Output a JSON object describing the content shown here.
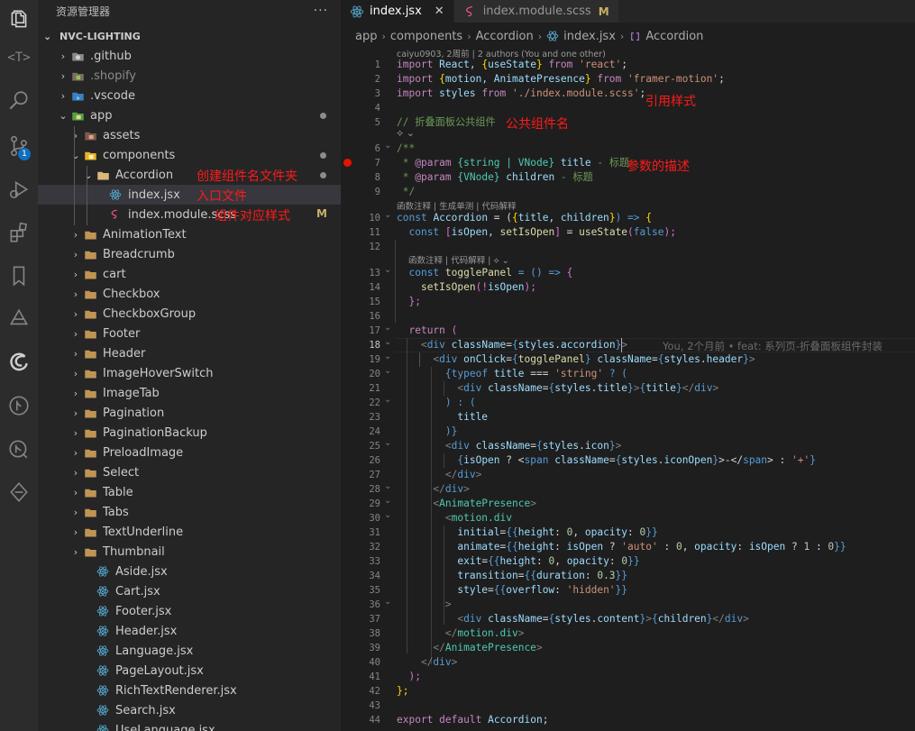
{
  "explorer": {
    "title": "资源管理器",
    "more": "···",
    "root": "NVC-LIGHTING",
    "items": [
      {
        "label": ".github",
        "kind": "folder",
        "chevron": "›"
      },
      {
        "label": ".shopify",
        "kind": "folder",
        "chevron": "›"
      },
      {
        "label": ".vscode",
        "kind": "folder",
        "chevron": "›"
      },
      {
        "label": "app",
        "kind": "folder-open",
        "chevron": "⌄"
      },
      {
        "label": "assets",
        "kind": "folder",
        "chevron": "›"
      },
      {
        "label": "components",
        "kind": "folder-open",
        "chevron": "⌄"
      },
      {
        "label": "Accordion",
        "kind": "folder-open",
        "chevron": "⌄",
        "note": "创建组件名文件夹"
      },
      {
        "label": "index.jsx",
        "kind": "react",
        "note": "入口文件"
      },
      {
        "label": "index.module.scss",
        "kind": "scss",
        "note": "组件对应样式",
        "badge": "M"
      },
      {
        "label": "AnimationText",
        "kind": "folder",
        "chevron": "›"
      },
      {
        "label": "Breadcrumb",
        "kind": "folder",
        "chevron": "›"
      },
      {
        "label": "cart",
        "kind": "folder",
        "chevron": "›"
      },
      {
        "label": "Checkbox",
        "kind": "folder",
        "chevron": "›"
      },
      {
        "label": "CheckboxGroup",
        "kind": "folder",
        "chevron": "›"
      },
      {
        "label": "Footer",
        "kind": "folder",
        "chevron": "›"
      },
      {
        "label": "Header",
        "kind": "folder",
        "chevron": "›"
      },
      {
        "label": "ImageHoverSwitch",
        "kind": "folder",
        "chevron": "›"
      },
      {
        "label": "ImageTab",
        "kind": "folder",
        "chevron": "›"
      },
      {
        "label": "Pagination",
        "kind": "folder",
        "chevron": "›"
      },
      {
        "label": "PaginationBackup",
        "kind": "folder",
        "chevron": "›"
      },
      {
        "label": "PreloadImage",
        "kind": "folder",
        "chevron": "›"
      },
      {
        "label": "Select",
        "kind": "folder",
        "chevron": "›"
      },
      {
        "label": "Table",
        "kind": "folder",
        "chevron": "›"
      },
      {
        "label": "Tabs",
        "kind": "folder",
        "chevron": "›"
      },
      {
        "label": "TextUnderline",
        "kind": "folder",
        "chevron": "›"
      },
      {
        "label": "Thumbnail",
        "kind": "folder",
        "chevron": "›"
      },
      {
        "label": "Aside.jsx",
        "kind": "react"
      },
      {
        "label": "Cart.jsx",
        "kind": "react"
      },
      {
        "label": "Footer.jsx",
        "kind": "react"
      },
      {
        "label": "Header.jsx",
        "kind": "react"
      },
      {
        "label": "Language.jsx",
        "kind": "react"
      },
      {
        "label": "PageLayout.jsx",
        "kind": "react"
      },
      {
        "label": "RichTextRenderer.jsx",
        "kind": "react"
      },
      {
        "label": "Search.jsx",
        "kind": "react"
      },
      {
        "label": "UseLanguage.jsx",
        "kind": "react"
      }
    ]
  },
  "activity_badge": "1",
  "activity_text_icon": "<T>",
  "tabs": [
    {
      "label": "index.jsx",
      "close": "✕"
    },
    {
      "label": "index.module.scss",
      "modified": "M"
    }
  ],
  "breadcrumb": [
    "app",
    "components",
    "Accordion",
    "index.jsx",
    "Accordion"
  ],
  "codelens": {
    "author": "caiyu0903, 2周前 | 2 authors (You and one other)",
    "lens1": "函数注释 | 生成单测 | 代码解释",
    "lens2": "函数注释 | 代码解释 |"
  },
  "blame": "You, 2个月前 • feat: 系列页-折叠面板组件封装",
  "annotations": {
    "import_styles": "引用样式",
    "component_name": "公共组件名",
    "param_desc": "参数的描述"
  },
  "line_numbers": [
    "1",
    "2",
    "3",
    "4",
    "5",
    "6",
    "7",
    "8",
    "9",
    "10",
    "11",
    "12",
    "13",
    "14",
    "15",
    "16",
    "17",
    "18",
    "19",
    "20",
    "21",
    "22",
    "23",
    "24",
    "25",
    "26",
    "27",
    "28",
    "29",
    "30",
    "31",
    "32",
    "33",
    "34",
    "35",
    "36",
    "37",
    "38",
    "39",
    "40",
    "41",
    "42",
    "43",
    "44"
  ],
  "code": {
    "l1": [
      "import",
      " React, ",
      "{",
      "useState",
      "}",
      " from ",
      "'react'",
      ";"
    ],
    "l2": [
      "import",
      " ",
      "{",
      "motion, AnimatePresence",
      "}",
      " from ",
      "'framer-motion'",
      ";"
    ],
    "l3": [
      "import",
      " styles ",
      "from",
      " ",
      "'./index.module.scss'",
      ";"
    ],
    "l5": "// 折叠面板公共组件",
    "l6": "/**",
    "l7": [
      " * ",
      "@param",
      " ",
      "{string | VNode}",
      " ",
      "title",
      " - 标题"
    ],
    "l8": [
      " * ",
      "@param",
      " ",
      "{VNode}",
      " ",
      "children",
      " - 标题"
    ],
    "l9": " */",
    "l10": [
      "const",
      " ",
      "Accordion",
      " = (",
      "{",
      "title, children",
      "}",
      ") => ",
      "{"
    ],
    "l11": [
      "  ",
      "const",
      " ",
      "[",
      "isOpen, ",
      "setIsOpen",
      "]",
      " = ",
      "useState",
      "(",
      "false",
      ");"
    ],
    "l13": [
      "  ",
      "const",
      " ",
      "togglePanel",
      " = () => ",
      "{"
    ],
    "l14": [
      "    ",
      "setIsOpen",
      "(!",
      "isOpen",
      ");"
    ],
    "l15": "  };",
    "l17": [
      "  ",
      "return",
      " ("
    ],
    "l18": [
      "    <",
      "div",
      " ",
      "className",
      "=",
      "{",
      "styles",
      ".",
      "accordion",
      "}",
      ">"
    ],
    "l19": [
      "      <",
      "div",
      " ",
      "onClick",
      "=",
      "{",
      "togglePanel",
      "}",
      " ",
      "className",
      "=",
      "{",
      "styles",
      ".",
      "header",
      "}",
      ">"
    ],
    "l20": [
      "        ",
      "{",
      "typeof",
      " ",
      "title",
      " === ",
      "'string'",
      " ? ("
    ],
    "l21": [
      "          <",
      "div",
      " ",
      "className",
      "=",
      "{",
      "styles",
      ".",
      "title",
      "}",
      ">",
      "{",
      "title",
      "}",
      "</",
      "div",
      ">"
    ],
    "l22": [
      "        ) : ("
    ],
    "l23": [
      "          ",
      "title"
    ],
    "l24": [
      "        )",
      "}"
    ],
    "l25": [
      "        <",
      "div",
      " ",
      "className",
      "=",
      "{",
      "styles",
      ".",
      "icon",
      "}",
      ">"
    ],
    "l26": [
      "          ",
      "{",
      "isOpen",
      " ? <",
      "span",
      " ",
      "className",
      "=",
      "{",
      "styles",
      ".",
      "iconOpen",
      "}",
      ">-</",
      "span",
      "> : ",
      "'+'",
      "}"
    ],
    "l27": [
      "        </",
      "div",
      ">"
    ],
    "l28": [
      "      </",
      "div",
      ">"
    ],
    "l29": [
      "      <",
      "AnimatePresence",
      ">"
    ],
    "l30": [
      "        <",
      "motion.div"
    ],
    "l31": [
      "          ",
      "initial",
      "=",
      "{{",
      "height",
      ": ",
      "0",
      ", ",
      "opacity",
      ": ",
      "0",
      "}}"
    ],
    "l32": [
      "          ",
      "animate",
      "=",
      "{{",
      "height",
      ": ",
      "isOpen",
      " ? ",
      "'auto'",
      " : ",
      "0",
      ", ",
      "opacity",
      ": ",
      "isOpen",
      " ? ",
      "1",
      " : ",
      "0",
      "}}"
    ],
    "l33": [
      "          ",
      "exit",
      "=",
      "{{",
      "height",
      ": ",
      "0",
      ", ",
      "opacity",
      ": ",
      "0",
      "}}"
    ],
    "l34": [
      "          ",
      "transition",
      "=",
      "{{",
      "duration",
      ": ",
      "0.3",
      "}}"
    ],
    "l35": [
      "          ",
      "style",
      "=",
      "{{",
      "overflow",
      ": ",
      "'hidden'",
      "}}"
    ],
    "l36": [
      "        >"
    ],
    "l37": [
      "          <",
      "div",
      " ",
      "className",
      "=",
      "{",
      "styles",
      ".",
      "content",
      "}",
      ">",
      "{",
      "children",
      "}",
      "</",
      "div",
      ">"
    ],
    "l38": [
      "        </",
      "motion.div",
      ">"
    ],
    "l39": [
      "      </",
      "AnimatePresence",
      ">"
    ],
    "l40": [
      "    </",
      "div",
      ">"
    ],
    "l41": [
      "  );"
    ],
    "l42": [
      "};"
    ],
    "l44": [
      "export",
      " ",
      "default",
      " ",
      "Accordion",
      ";"
    ]
  },
  "colors": {
    "annotation": "#ff1a1a",
    "keyword": "#c586c0",
    "string": "#ce9178",
    "variable": "#9cdcfe",
    "badge": "#0e70c0"
  }
}
